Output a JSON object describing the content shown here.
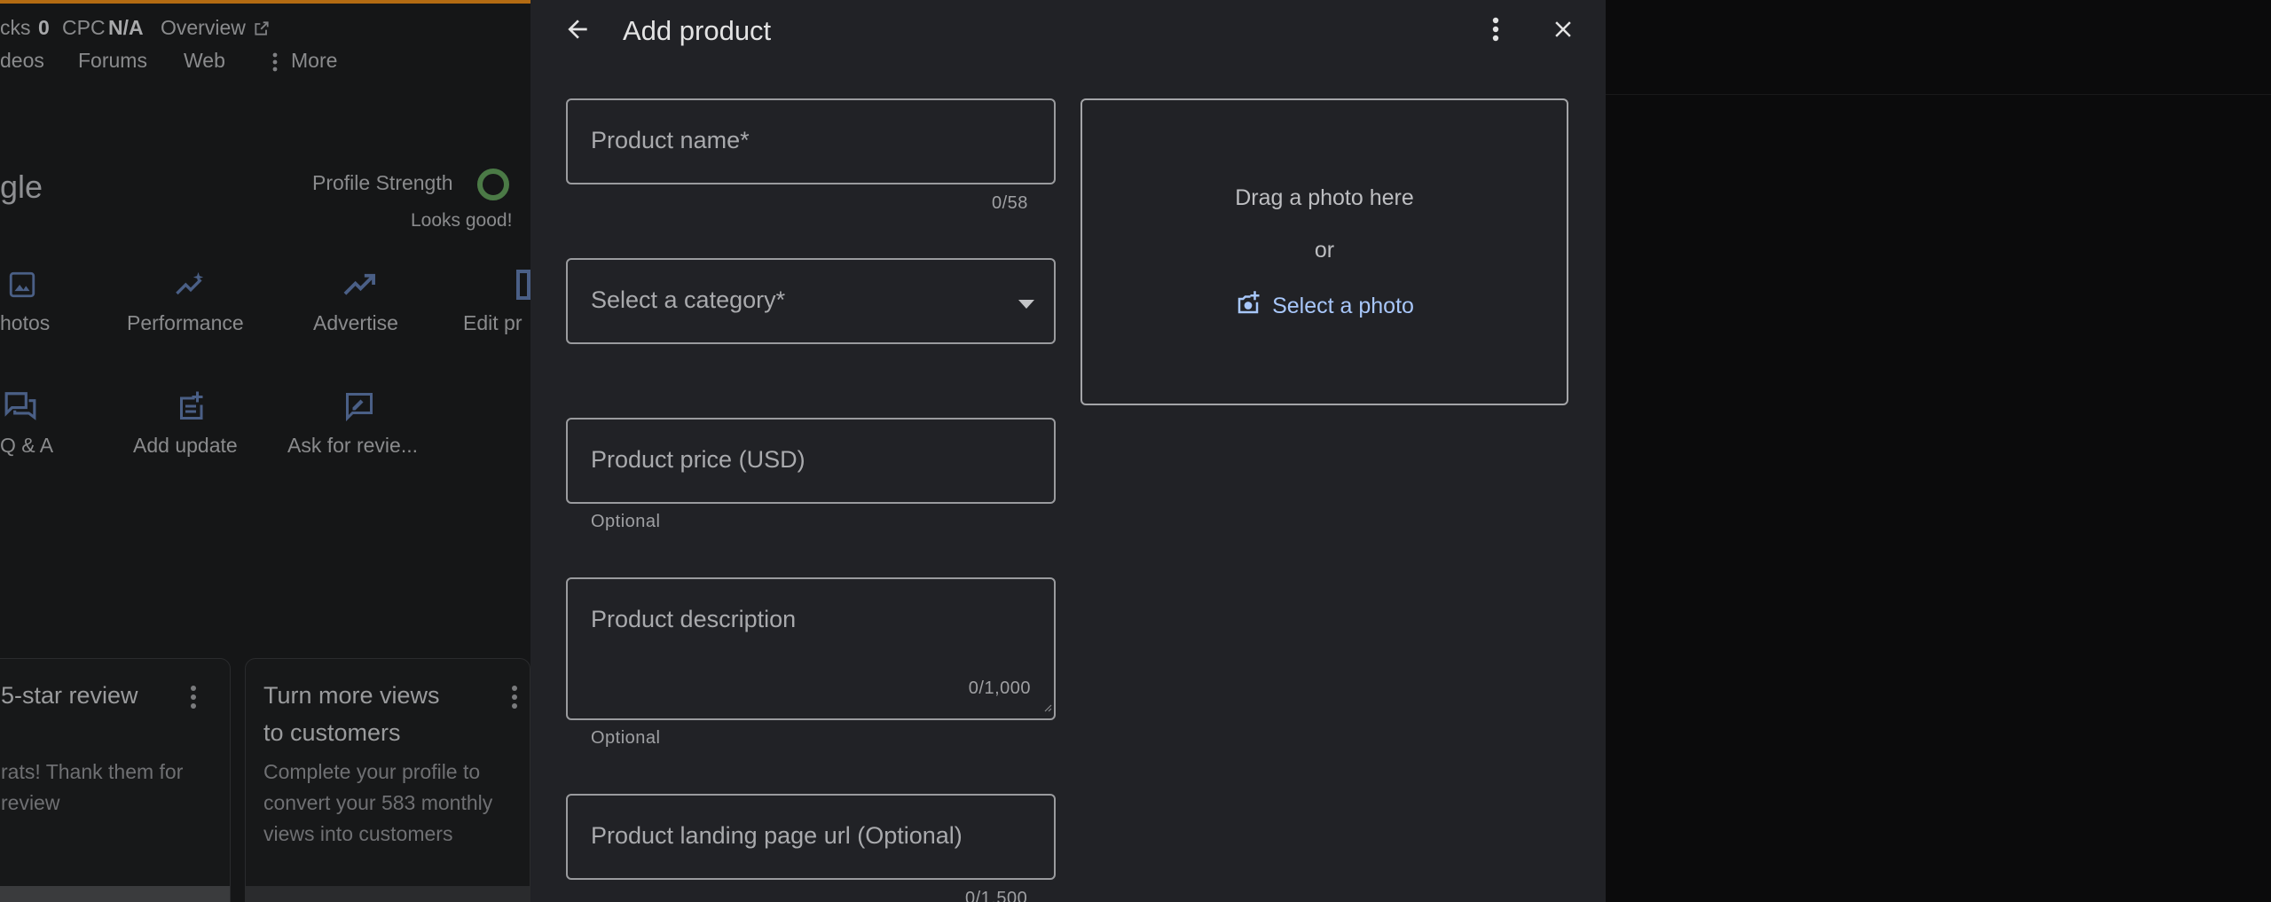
{
  "background": {
    "stats": {
      "clicks_label": "cks",
      "clicks_value": "0",
      "cpc_label": "CPC",
      "cpc_value": "N/A",
      "overview_label": "Overview"
    },
    "search_tabs": [
      "deos",
      "Forums",
      "Web",
      "More"
    ],
    "business_name_fragment": "gle",
    "profile_strength": {
      "label": "Profile Strength",
      "status": "Looks good!"
    },
    "actions_row1": [
      "hotos",
      "Performance",
      "Advertise",
      "Edit pr"
    ],
    "actions_row2": [
      "Q & A",
      "Add update",
      "Ask for revie..."
    ],
    "cards": [
      {
        "title": "5-star review",
        "text_line1": "rats! Thank them for",
        "text_line2": "review"
      },
      {
        "title_line1": "Turn more views",
        "title_line2": "to customers",
        "text_line1": "Complete your profile to",
        "text_line2": "convert your 583 monthly",
        "text_line3": "views into customers"
      }
    ]
  },
  "modal": {
    "title": "Add product",
    "fields": {
      "product_name": {
        "placeholder": "Product name*",
        "counter": "0/58"
      },
      "category": {
        "placeholder": "Select a category*"
      },
      "price": {
        "placeholder": "Product price (USD)",
        "helper": "Optional"
      },
      "description": {
        "placeholder": "Product description",
        "counter": "0/1,000",
        "helper": "Optional"
      },
      "landing_url": {
        "placeholder": "Product landing page url (Optional)",
        "counter": "0/1,500"
      }
    },
    "photo": {
      "drag_text": "Drag a photo here",
      "or_text": "or",
      "select_label": "Select a photo"
    }
  },
  "colors": {
    "accent_link": "#a8c7fa",
    "panel_bg": "#212226",
    "top_bar_accent": "#b36b12",
    "ring_green": "#4b7a46"
  },
  "icons": [
    "arrow-back-icon",
    "more-vert-icon",
    "close-icon",
    "dropdown-arrow-icon",
    "add-photo-icon",
    "image-icon",
    "sparkle-chart-icon",
    "trending-up-icon",
    "storefront-icon",
    "forum-icon",
    "post-add-icon",
    "rate-review-icon",
    "external-link-icon"
  ]
}
